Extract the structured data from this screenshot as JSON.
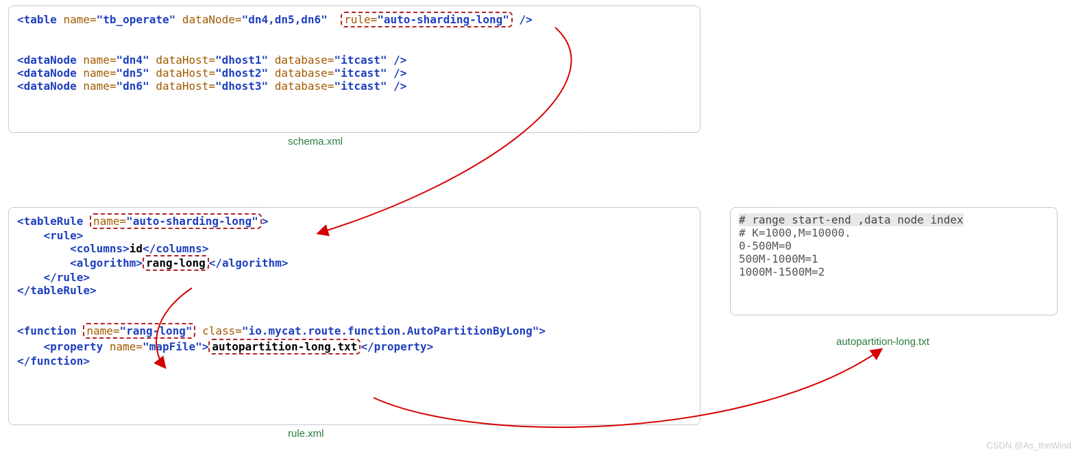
{
  "schema_box": {
    "label": "schema.xml",
    "l1_tag": "table",
    "l1_a1": "name=",
    "l1_v1": "\"tb_operate\"",
    "l1_a2": "dataNode=",
    "l1_v2": "\"dn4,dn5,dn6\"",
    "l1_a3": "rule=",
    "l1_v3": "\"auto-sharding-long\"",
    "dn4_tag": "dataNode",
    "dn4_na": "name=",
    "dn4_nv": "\"dn4\"",
    "dn4_ha": "dataHost=",
    "dn4_hv": "\"dhost1\"",
    "dn4_da": "database=",
    "dn4_dv": "\"itcast\"",
    "dn5_tag": "dataNode",
    "dn5_na": "name=",
    "dn5_nv": "\"dn5\"",
    "dn5_ha": "dataHost=",
    "dn5_hv": "\"dhost2\"",
    "dn5_da": "database=",
    "dn5_dv": "\"itcast\"",
    "dn6_tag": "dataNode",
    "dn6_na": "name=",
    "dn6_nv": "\"dn6\"",
    "dn6_ha": "dataHost=",
    "dn6_hv": "\"dhost3\"",
    "dn6_da": "database=",
    "dn6_dv": "\"itcast\""
  },
  "rule_box": {
    "label": "rule.xml",
    "tr_open": "tableRule",
    "tr_name_a": "name=",
    "tr_name_v": "\"auto-sharding-long\"",
    "rule_open": "rule",
    "cols_tag": "columns",
    "cols_txt": "id",
    "algo_tag": "algorithm",
    "algo_txt": "rang-long",
    "fn_open": "function",
    "fn_name_a": "name=",
    "fn_name_v": "\"rang-long\"",
    "fn_class_a": "class=",
    "fn_class_v": "\"io.mycat.route.function.AutoPartitionByLong\"",
    "prop_tag": "property",
    "prop_na": "name=",
    "prop_nv": "\"mapFile\"",
    "prop_txt": "autopartition-long.txt"
  },
  "txt_box": {
    "label": "autopartition-long.txt",
    "c1": "# range start-end ,data node index",
    "c2": "# K=1000,M=10000.",
    "l1": "0-500M=0",
    "l2": "500M-1000M=1",
    "l3": "1000M-1500M=2"
  },
  "watermark": "CSDN @As_theWind"
}
